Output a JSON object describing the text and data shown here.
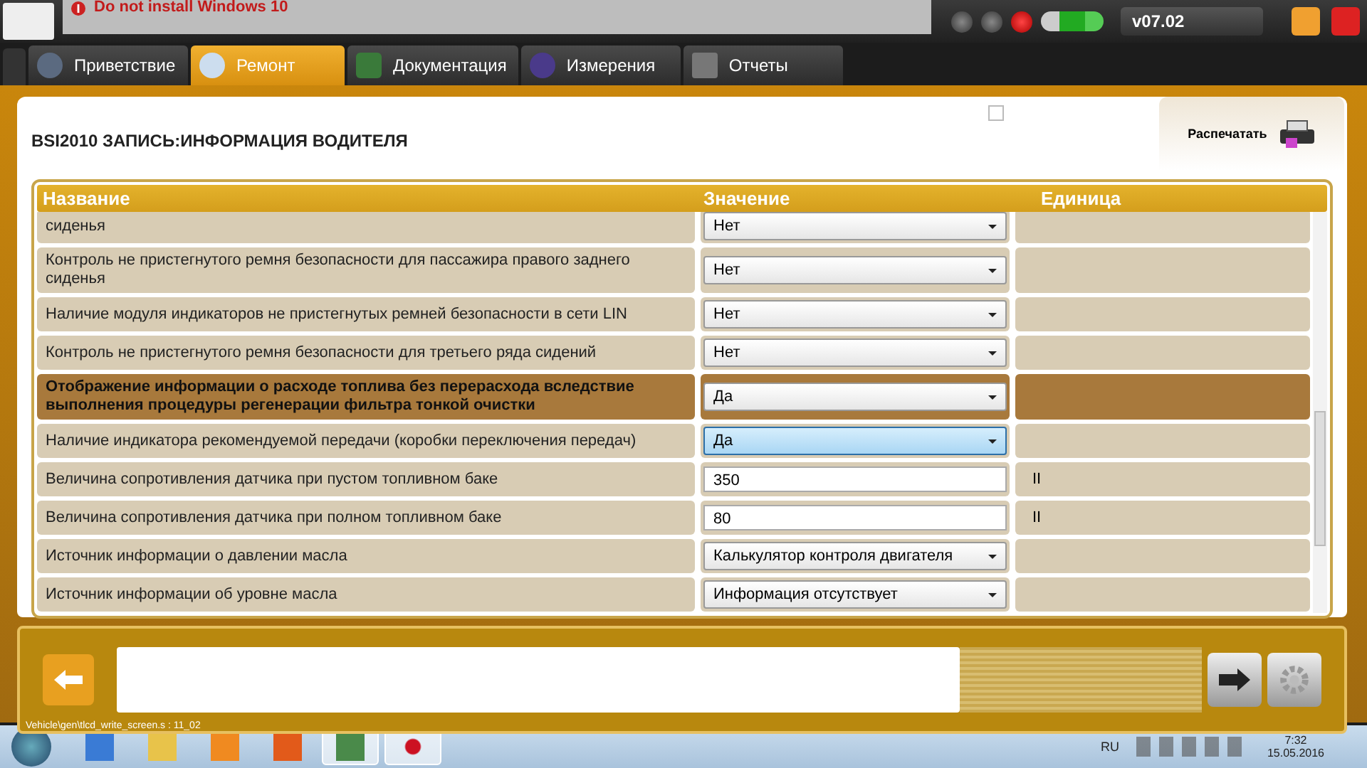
{
  "top_bar": {
    "message": "Do not install Windows 10",
    "version": "v07.02"
  },
  "tabs": [
    {
      "label": "Приветствие",
      "selected": false
    },
    {
      "label": "Ремонт",
      "selected": true
    },
    {
      "label": "Документация",
      "selected": false
    },
    {
      "label": "Измерения",
      "selected": false
    },
    {
      "label": "Отчеты",
      "selected": false
    }
  ],
  "panel": {
    "title": "BSI2010  ЗАПИСЬ:ИНФОРМАЦИЯ ВОДИТЕЛЯ",
    "print_button": "Распечатать",
    "checked": false
  },
  "table": {
    "columns": [
      "Название",
      "Значение",
      "Единица"
    ],
    "rows": [
      {
        "name": "сиденья",
        "kind": "select",
        "value": "Нет",
        "unit": "",
        "selected": false,
        "hovered": false
      },
      {
        "name": "Контроль не пристегнутого ремня безопасности для пассажира правого заднего сиденья",
        "kind": "select",
        "value": "Нет",
        "unit": "",
        "selected": false,
        "hovered": false
      },
      {
        "name": "Наличие модуля индикаторов не пристегнутых ремней безопасности в сети LIN",
        "kind": "select",
        "value": "Нет",
        "unit": "",
        "selected": false,
        "hovered": false
      },
      {
        "name": "Контроль не пристегнутого ремня безопасности для третьего ряда сидений",
        "kind": "select",
        "value": "Нет",
        "unit": "",
        "selected": false,
        "hovered": false
      },
      {
        "name": "Отображение информации о расходе топлива без перерасхода вследствие выполнения процедуры регенерации фильтра тонкой очистки",
        "kind": "select",
        "value": "Да",
        "unit": "",
        "selected": true,
        "hovered": false
      },
      {
        "name": "Наличие индикатора рекомендуемой передачи (коробки переключения передач)",
        "kind": "select",
        "value": "Да",
        "unit": "",
        "selected": false,
        "hovered": true
      },
      {
        "name": "Величина сопротивления датчика при пустом топливном баке",
        "kind": "input",
        "value": "350",
        "unit": "II",
        "selected": false
      },
      {
        "name": "Величина сопротивления датчика при полном топливном баке",
        "kind": "input",
        "value": "80",
        "unit": "II",
        "selected": false
      },
      {
        "name": "Источник информации о давлении масла",
        "kind": "select",
        "value": "Калькулятор контроля двигателя",
        "unit": "",
        "selected": false,
        "hovered": false
      },
      {
        "name": "Источник информации об уровне масла",
        "kind": "select",
        "value": "Информация отсутствует",
        "unit": "",
        "selected": false,
        "hovered": false
      }
    ]
  },
  "status_path": "Vehicle\\gen\\tlcd_write_screen.s : 11_02",
  "taskbar": {
    "apps": [
      {
        "selected": false
      },
      {
        "selected": false
      },
      {
        "selected": false
      },
      {
        "selected": false
      },
      {
        "selected": true
      },
      {
        "selected": true
      }
    ],
    "language": "RU",
    "time": "7:32",
    "date": "15.05.2016"
  }
}
